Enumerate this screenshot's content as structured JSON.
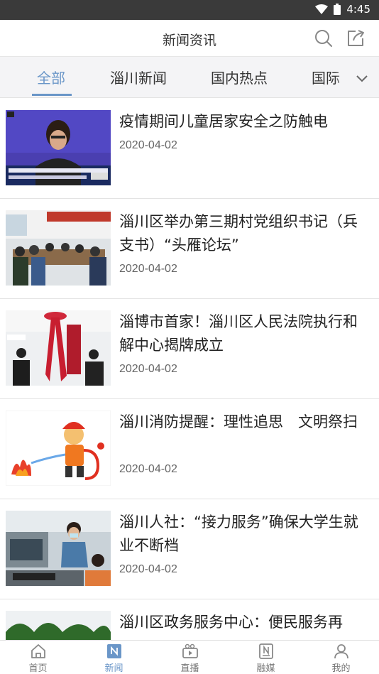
{
  "status_bar": {
    "time": "4:45"
  },
  "header": {
    "title": "新闻资讯"
  },
  "tabs": [
    {
      "label": "全部",
      "active": true
    },
    {
      "label": "淄川新闻",
      "active": false
    },
    {
      "label": "国内热点",
      "active": false
    },
    {
      "label": "国际",
      "active": false
    }
  ],
  "news": [
    {
      "title": "疫情期间儿童居家安全之防触电",
      "date": "2020-04-02",
      "thumb_icon": "press-conference-photo"
    },
    {
      "title": "淄川区举办第三期村党组织书记（兵支书）“头雁论坛”",
      "date": "2020-04-02",
      "thumb_icon": "meeting-room-photo"
    },
    {
      "title": "淄博市首家！淄川区人民法院执行和解中心揭牌成立",
      "date": "2020-04-02",
      "thumb_icon": "unveiling-ceremony-photo"
    },
    {
      "title": "淄川消防提醒：理性追思　文明祭扫",
      "date": "2020-04-02",
      "thumb_icon": "firefighter-cartoon"
    },
    {
      "title": "淄川人社：“接力服务”确保大学生就业不断档",
      "date": "2020-04-02",
      "thumb_icon": "office-workers-photo"
    },
    {
      "title": "淄川区政务服务中心：便民服务再",
      "date": "",
      "thumb_icon": "service-center-photo"
    }
  ],
  "bottom_nav": [
    {
      "label": "首页",
      "icon": "home-icon",
      "active": false
    },
    {
      "label": "新闻",
      "icon": "news-icon",
      "active": true
    },
    {
      "label": "直播",
      "icon": "live-camera-icon",
      "active": false
    },
    {
      "label": "融媒",
      "icon": "media-icon",
      "active": false
    },
    {
      "label": "我的",
      "icon": "profile-icon",
      "active": false
    }
  ],
  "colors": {
    "accent": "#6a96c8",
    "status_bar": "#3a3a3a",
    "tab_bar_bg": "#f4f4f6"
  }
}
